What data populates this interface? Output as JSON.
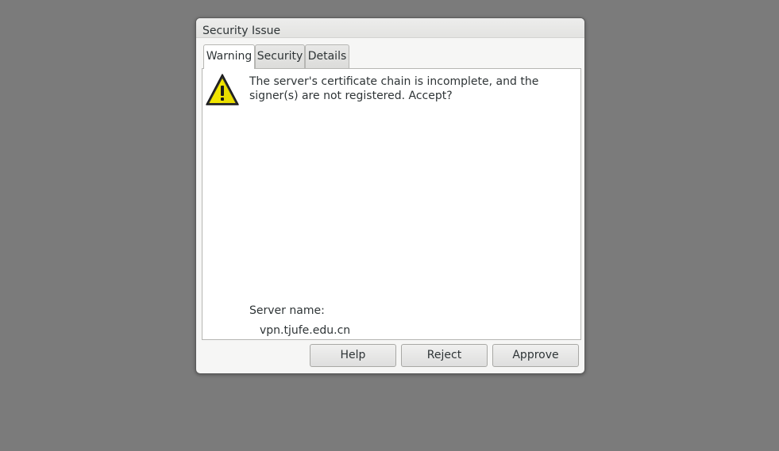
{
  "dialog": {
    "title": "Security Issue",
    "tabs": [
      {
        "label": "Warning",
        "active": true
      },
      {
        "label": "Security",
        "active": false
      },
      {
        "label": "Details",
        "active": false
      }
    ],
    "icon": "warning-triangle-icon",
    "message": "The server's certificate chain is incomplete, and the signer(s) are not registered. Accept?",
    "server_name_label": "Server name:",
    "server_name_value": "vpn.tjufe.edu.cn",
    "buttons": {
      "help": "Help",
      "reject": "Reject",
      "approve": "Approve"
    }
  },
  "colors": {
    "desktop_background": "#7b7b7b",
    "warning_yellow": "#f2e600"
  }
}
